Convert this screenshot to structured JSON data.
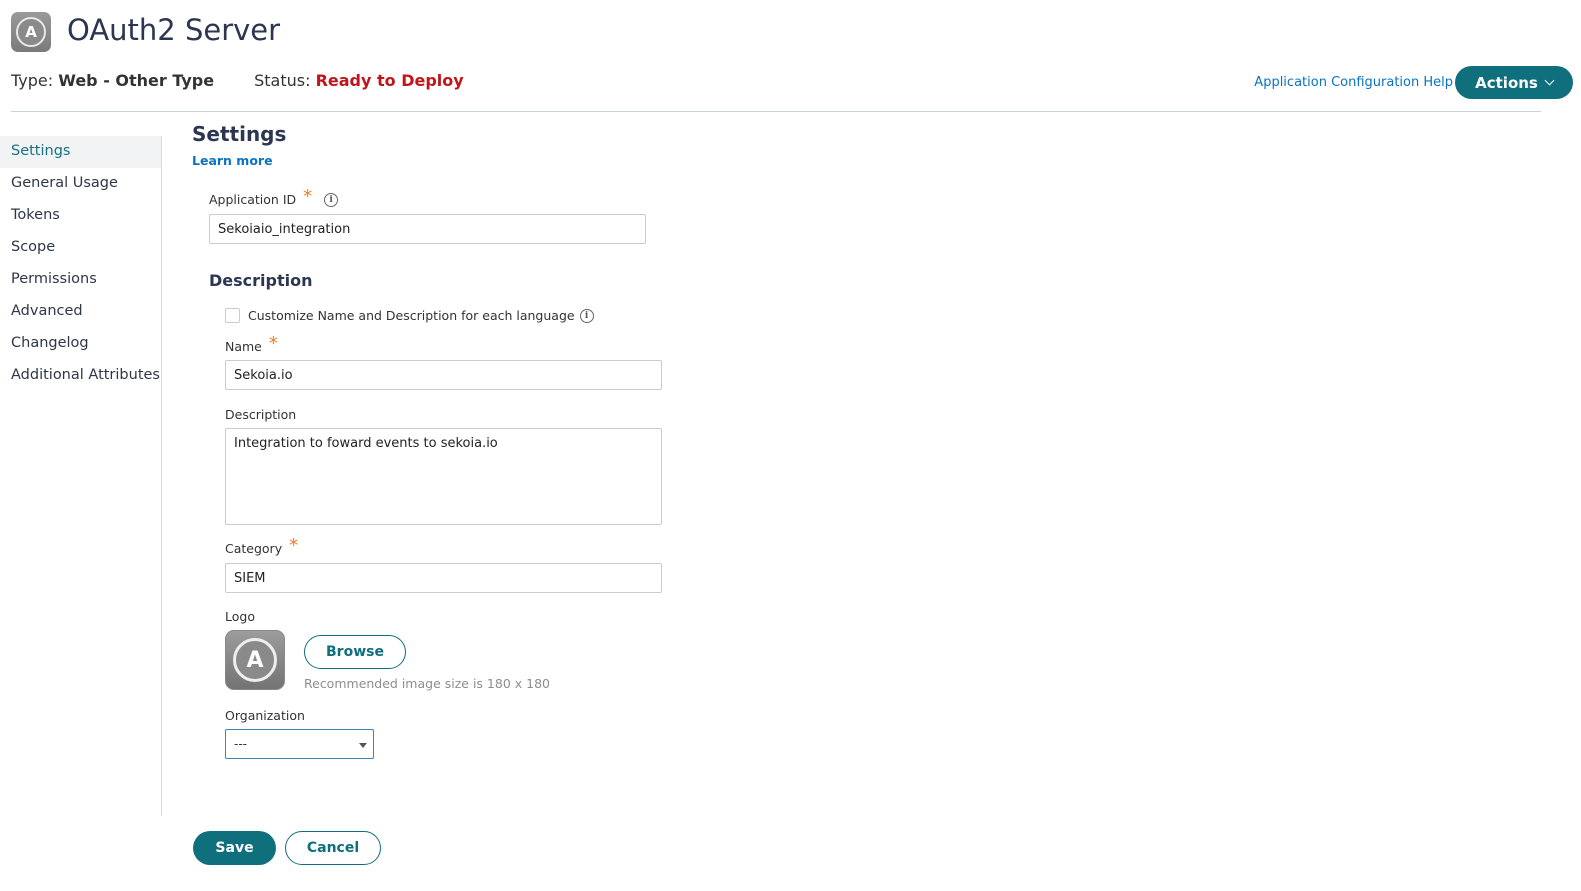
{
  "header": {
    "app_name": "OAuth2 Server",
    "logo_letter": "A",
    "type_label": "Type:",
    "type_value": "Web - Other Type",
    "status_label": "Status:",
    "status_value": "Ready to Deploy",
    "help_link": "Application Configuration Help",
    "actions_label": "Actions"
  },
  "sidebar": {
    "items": [
      {
        "label": "Settings",
        "active": true
      },
      {
        "label": "General Usage"
      },
      {
        "label": "Tokens"
      },
      {
        "label": "Scope"
      },
      {
        "label": "Permissions"
      },
      {
        "label": "Advanced"
      },
      {
        "label": "Changelog"
      },
      {
        "label": "Additional Attributes"
      }
    ]
  },
  "settings": {
    "title": "Settings",
    "learn_more": "Learn more",
    "app_id_label": "Application ID",
    "app_id_value": "Sekoiaio_integration",
    "description_heading": "Description",
    "customize_label": "Customize Name and Description for each language",
    "name_label": "Name",
    "name_value": "Sekoia.io",
    "description_label": "Description",
    "description_value": "Integration to foward events to sekoia.io",
    "category_label": "Category",
    "category_value": "SIEM",
    "logo_label": "Logo",
    "browse_label": "Browse",
    "logo_hint": "Recommended image size is 180 x 180",
    "organization_label": "Organization",
    "organization_value": "---"
  },
  "footer": {
    "save_label": "Save",
    "cancel_label": "Cancel"
  },
  "icons": {
    "required": "*",
    "info": "i"
  },
  "colors": {
    "primary": "#0f6f7c",
    "link": "#0a73c2",
    "status": "#c0151b",
    "required": "#f07c22"
  }
}
